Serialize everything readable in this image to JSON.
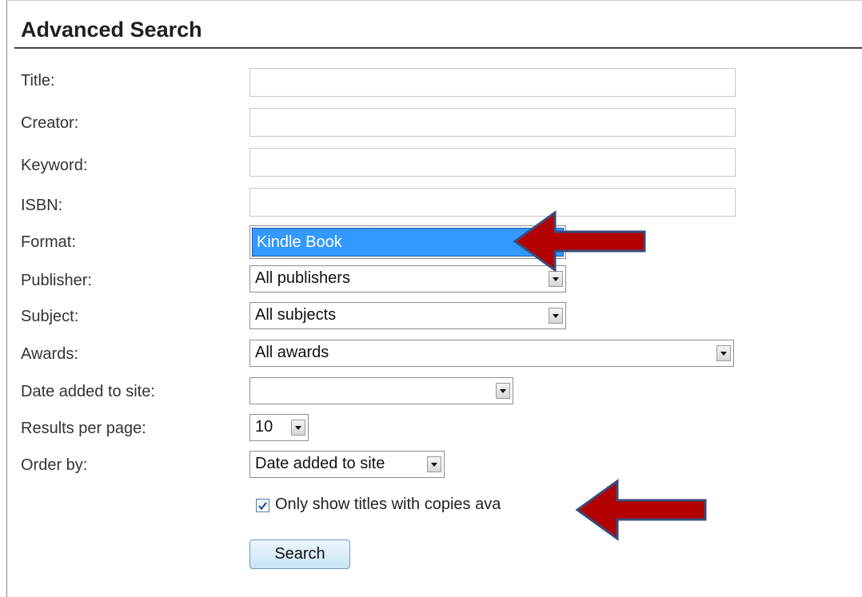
{
  "page": {
    "heading": "Advanced Search"
  },
  "form": {
    "title_label": "Title:",
    "title_value": "",
    "creator_label": "Creator:",
    "creator_value": "",
    "keyword_label": "Keyword:",
    "keyword_value": "",
    "isbn_label": "ISBN:",
    "isbn_value": "",
    "format_label": "Format:",
    "format_selected": "Kindle Book",
    "publisher_label": "Publisher:",
    "publisher_selected": "All publishers",
    "subject_label": "Subject:",
    "subject_selected": "All subjects",
    "awards_label": "Awards:",
    "awards_selected": "All awards",
    "date_added_label": "Date added to site:",
    "date_added_selected": "",
    "results_per_page_label": "Results per page:",
    "results_per_page_selected": "10",
    "order_by_label": "Order by:",
    "order_by_selected": "Date added to site",
    "available_checkbox_label": "Only show titles with copies ava",
    "available_checked": true,
    "search_button_label": "Search"
  },
  "colors": {
    "selection_highlight": "#3399ff",
    "annotation_arrow": "#b30000",
    "annotation_outline": "#3a4a7a"
  },
  "icons": {
    "dropdown": "chevron-down-icon",
    "arrow": "arrow-left-icon",
    "check": "checkmark-icon"
  }
}
